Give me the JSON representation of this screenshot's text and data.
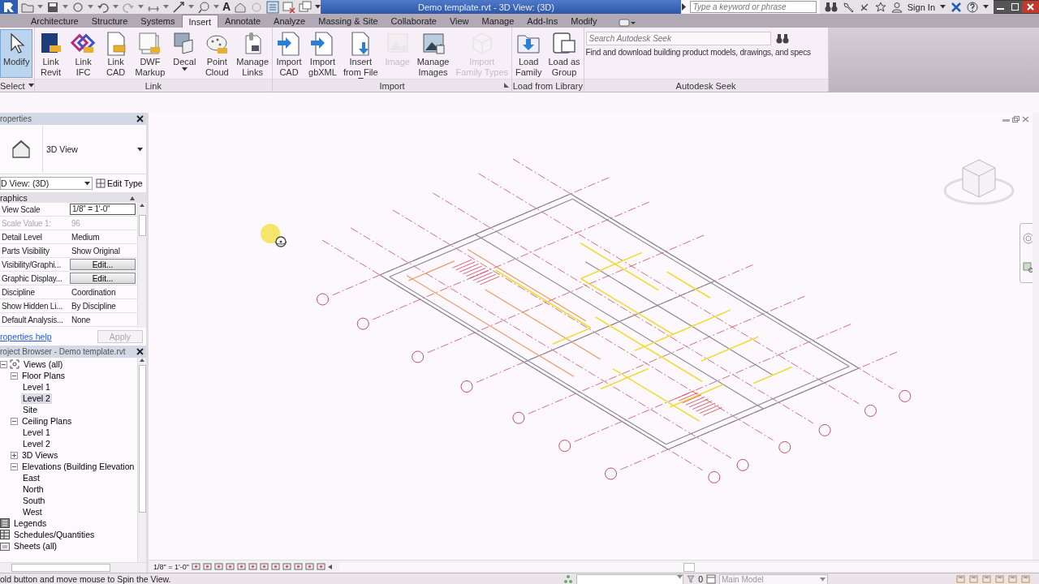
{
  "title_bar": {
    "text_tool": "A",
    "title": "Demo template.rvt - 3D View: (3D)",
    "search_placeholder": "Type a keyword or phrase",
    "sign_in": "Sign In"
  },
  "tabs": [
    {
      "label": "Architecture",
      "selected": false
    },
    {
      "label": "Structure",
      "selected": false
    },
    {
      "label": "Systems",
      "selected": false
    },
    {
      "label": "Insert",
      "selected": true
    },
    {
      "label": "Annotate",
      "selected": false
    },
    {
      "label": "Analyze",
      "selected": false
    },
    {
      "label": "Massing & Site",
      "selected": false
    },
    {
      "label": "Collaborate",
      "selected": false
    },
    {
      "label": "View",
      "selected": false
    },
    {
      "label": "Manage",
      "selected": false
    },
    {
      "label": "Add-Ins",
      "selected": false
    },
    {
      "label": "Modify",
      "selected": false
    }
  ],
  "ribbon": {
    "panels": [
      {
        "name": "Select",
        "menu": true,
        "launcher": false,
        "buttons": [
          {
            "label": "Modify",
            "selected": true,
            "disabled": false,
            "menu": false
          }
        ]
      },
      {
        "name": "Link",
        "menu": false,
        "launcher": false,
        "buttons": [
          {
            "label": "Link\nRevit",
            "selected": false,
            "disabled": false,
            "menu": false
          },
          {
            "label": "Link\nIFC",
            "selected": false,
            "disabled": false,
            "menu": false
          },
          {
            "label": "Link\nCAD",
            "selected": false,
            "disabled": false,
            "menu": false
          },
          {
            "label": "DWF\nMarkup",
            "selected": false,
            "disabled": false,
            "menu": false
          },
          {
            "label": "Decal",
            "selected": false,
            "disabled": false,
            "menu": true
          },
          {
            "label": "Point\nCloud",
            "selected": false,
            "disabled": false,
            "menu": false
          },
          {
            "label": "Manage\nLinks",
            "selected": false,
            "disabled": false,
            "menu": false
          }
        ]
      },
      {
        "name": "Import",
        "menu": false,
        "launcher": true,
        "buttons": [
          {
            "label": "Import\nCAD",
            "selected": false,
            "disabled": false,
            "menu": false
          },
          {
            "label": "Import\ngbXML",
            "selected": false,
            "disabled": false,
            "menu": false
          },
          {
            "label": "Insert\nfrom File",
            "selected": false,
            "disabled": false,
            "menu": true
          },
          {
            "label": "Image",
            "selected": false,
            "disabled": true,
            "menu": false
          },
          {
            "label": "Manage\nImages",
            "selected": false,
            "disabled": false,
            "menu": false
          },
          {
            "label": "Import\nFamily Types",
            "selected": false,
            "disabled": true,
            "menu": false
          }
        ]
      },
      {
        "name": "Load from Library",
        "menu": false,
        "launcher": false,
        "buttons": [
          {
            "label": "Load\nFamily",
            "selected": false,
            "disabled": false,
            "menu": false
          },
          {
            "label": "Load as\nGroup",
            "selected": false,
            "disabled": false,
            "menu": false
          }
        ]
      }
    ],
    "seek": {
      "name": "Autodesk Seek",
      "placeholder": "Search Autodesk Seek",
      "description": "Find and download building product models, drawings, and specs"
    }
  },
  "properties": {
    "title": "roperties",
    "type_name": "3D View",
    "instance": "D View: (3D)",
    "edit_type": "Edit Type",
    "group": "raphics",
    "rows": [
      {
        "name": "View Scale",
        "value": "1/8\" = 1'-0\"",
        "kind": "field",
        "disabled": false
      },
      {
        "name": "Scale Value 1:",
        "value": "96",
        "kind": "text",
        "disabled": true
      },
      {
        "name": "Detail Level",
        "value": "Medium",
        "kind": "text",
        "disabled": false
      },
      {
        "name": "Parts Visibility",
        "value": "Show Original",
        "kind": "text",
        "disabled": false
      },
      {
        "name": "Visibility/Graphi...",
        "value": "Edit...",
        "kind": "button",
        "disabled": false
      },
      {
        "name": "Graphic Display...",
        "value": "Edit...",
        "kind": "button",
        "disabled": false
      },
      {
        "name": "Discipline",
        "value": "Coordination",
        "kind": "text",
        "disabled": false
      },
      {
        "name": "Show Hidden Li...",
        "value": "By Discipline",
        "kind": "text",
        "disabled": false
      },
      {
        "name": "Default Analysis...",
        "value": "None",
        "kind": "text",
        "disabled": false
      }
    ],
    "help": "roperties help",
    "apply": "Apply",
    "apply_disabled": true
  },
  "project_browser": {
    "title": "roject Browser - Demo template.rvt",
    "tree": [
      {
        "label": "Views (all)",
        "kind": "views",
        "expanded": true,
        "selected": false,
        "children": [
          {
            "label": "Floor Plans",
            "expanded": true,
            "selected": false,
            "children": [
              {
                "label": "Level 1",
                "selected": false
              },
              {
                "label": "Level 2",
                "selected": true
              },
              {
                "label": "Site",
                "selected": false
              }
            ]
          },
          {
            "label": "Ceiling Plans",
            "expanded": true,
            "selected": false,
            "children": [
              {
                "label": "Level 1",
                "selected": false
              },
              {
                "label": "Level 2",
                "selected": false
              }
            ]
          },
          {
            "label": "3D Views",
            "expanded": false,
            "selected": false
          },
          {
            "label": "Elevations (Building Elevation",
            "expanded": true,
            "selected": false,
            "children": [
              {
                "label": "East",
                "selected": false
              },
              {
                "label": "North",
                "selected": false
              },
              {
                "label": "South",
                "selected": false
              },
              {
                "label": "West",
                "selected": false
              }
            ]
          }
        ]
      },
      {
        "label": "Legends",
        "kind": "legend",
        "selected": false
      },
      {
        "label": "Schedules/Quantities",
        "kind": "schedule",
        "selected": false
      },
      {
        "label": "Sheets (all)",
        "kind": "sheet",
        "selected": false
      }
    ]
  },
  "view_control_bar": {
    "scale": "1/8\" = 1'-0\""
  },
  "status_bar": {
    "message": "old button and move mouse to Spin the View.",
    "count": "0",
    "model": "Main Model"
  }
}
